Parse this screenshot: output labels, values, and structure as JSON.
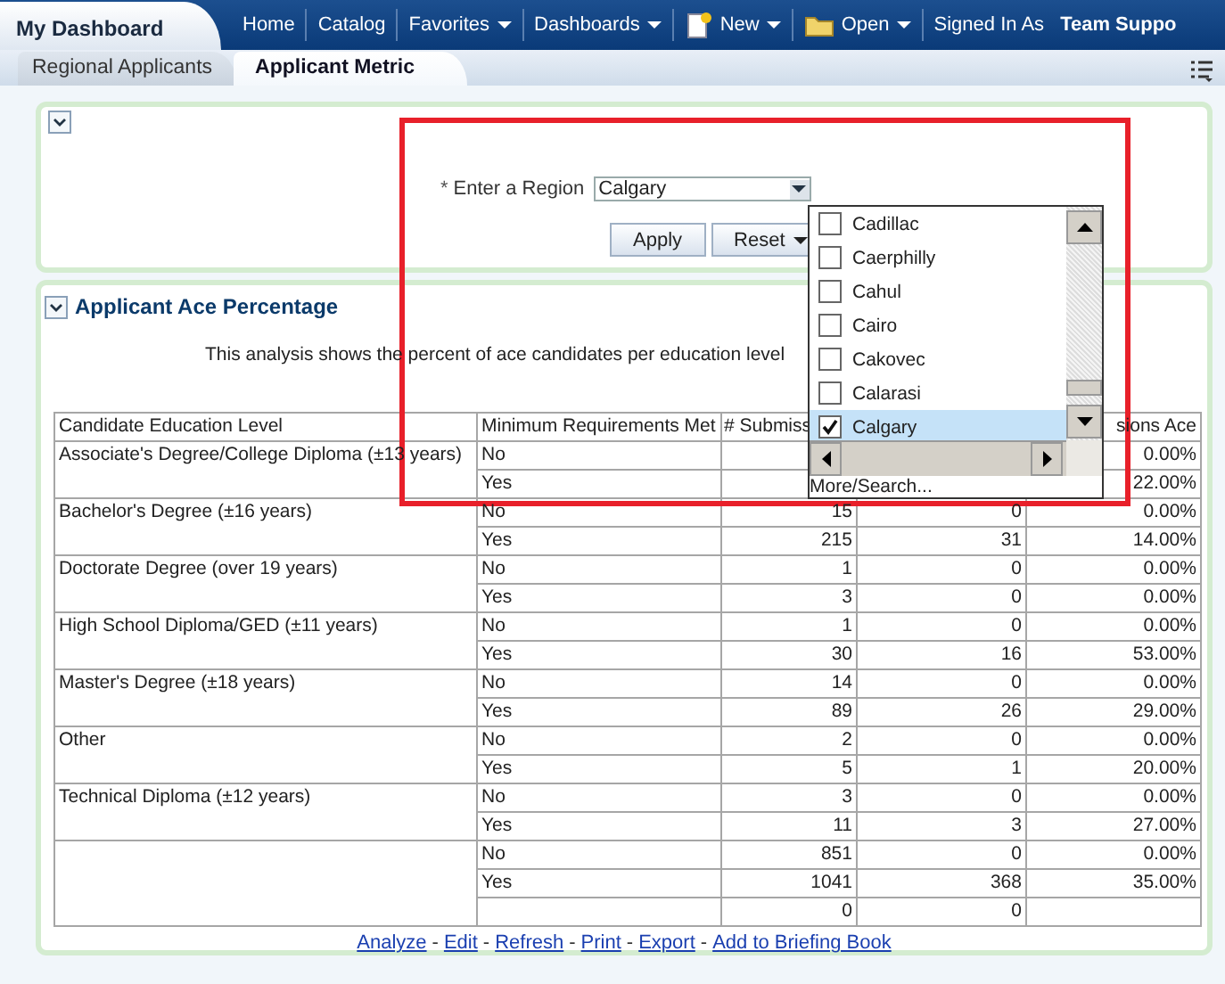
{
  "header": {
    "title": "My Dashboard",
    "nav": [
      {
        "label": "Home",
        "menu": false
      },
      {
        "label": "Catalog",
        "menu": false
      },
      {
        "label": "Favorites",
        "menu": true
      },
      {
        "label": "Dashboards",
        "menu": true
      },
      {
        "label": "New",
        "menu": true,
        "kind": "document"
      },
      {
        "label": "Open",
        "menu": true,
        "kind": "folder"
      }
    ],
    "signed_in_label": "Signed In As",
    "user": "Team Suppo"
  },
  "tabs": [
    {
      "label": "Regional Applicants",
      "selected": false
    },
    {
      "label": "Applicant Metric",
      "selected": true
    }
  ],
  "prompts": {
    "required_mark": "*",
    "label": "Enter a Region",
    "value": "Calgary",
    "buttons": [
      {
        "label": "Apply",
        "menu": false
      },
      {
        "label": "Reset",
        "menu": true
      }
    ]
  },
  "dropdown": {
    "options": [
      {
        "label": "Cadillac",
        "checked": false,
        "selected": false
      },
      {
        "label": "Caerphilly",
        "checked": false,
        "selected": false
      },
      {
        "label": "Cahul",
        "checked": false,
        "selected": false
      },
      {
        "label": "Cairo",
        "checked": false,
        "selected": false
      },
      {
        "label": "Cakovec",
        "checked": false,
        "selected": false
      },
      {
        "label": "Calarasi",
        "checked": false,
        "selected": false
      },
      {
        "label": "Calgary",
        "checked": true,
        "selected": true
      }
    ],
    "footer": "More/Search..."
  },
  "section": {
    "title": "Applicant Ace Percentage",
    "description": "This analysis shows the percent of ace candidates per education level",
    "table": {
      "columns": [
        "Candidate Education Level",
        "Minimum Requirements Met",
        "# Submiss",
        null,
        "sions Ace"
      ],
      "groups": [
        {
          "label": "Associate's Degree/College Diploma (±13 years)",
          "rows": [
            [
              "No",
              null,
              null,
              "0.00%"
            ],
            [
              "Yes",
              null,
              null,
              "22.00%"
            ]
          ]
        },
        {
          "label": "Bachelor's Degree (±16 years)",
          "rows": [
            [
              "No",
              "15",
              "0",
              "0.00%"
            ],
            [
              "Yes",
              "215",
              "31",
              "14.00%"
            ]
          ]
        },
        {
          "label": "Doctorate Degree (over 19 years)",
          "rows": [
            [
              "No",
              "1",
              "0",
              "0.00%"
            ],
            [
              "Yes",
              "3",
              "0",
              "0.00%"
            ]
          ]
        },
        {
          "label": "High School Diploma/GED (±11 years)",
          "rows": [
            [
              "No",
              "1",
              "0",
              "0.00%"
            ],
            [
              "Yes",
              "30",
              "16",
              "53.00%"
            ]
          ]
        },
        {
          "label": "Master's Degree (±18 years)",
          "rows": [
            [
              "No",
              "14",
              "0",
              "0.00%"
            ],
            [
              "Yes",
              "89",
              "26",
              "29.00%"
            ]
          ]
        },
        {
          "label": "Other",
          "rows": [
            [
              "No",
              "2",
              "0",
              "0.00%"
            ],
            [
              "Yes",
              "5",
              "1",
              "20.00%"
            ]
          ]
        },
        {
          "label": "Technical Diploma (±12 years)",
          "rows": [
            [
              "No",
              "3",
              "0",
              "0.00%"
            ],
            [
              "Yes",
              "11",
              "3",
              "27.00%"
            ]
          ]
        },
        {
          "rows": [
            [
              "No",
              "851",
              "0",
              "0.00%"
            ],
            [
              "Yes",
              "1041",
              "368",
              "35.00%"
            ],
            [
              null,
              "0",
              "0",
              null
            ]
          ]
        }
      ]
    },
    "links": [
      "Analyze",
      "Edit",
      "Refresh",
      "Print",
      "Export",
      "Add to Briefing Book"
    ],
    "link_separator": "-"
  }
}
